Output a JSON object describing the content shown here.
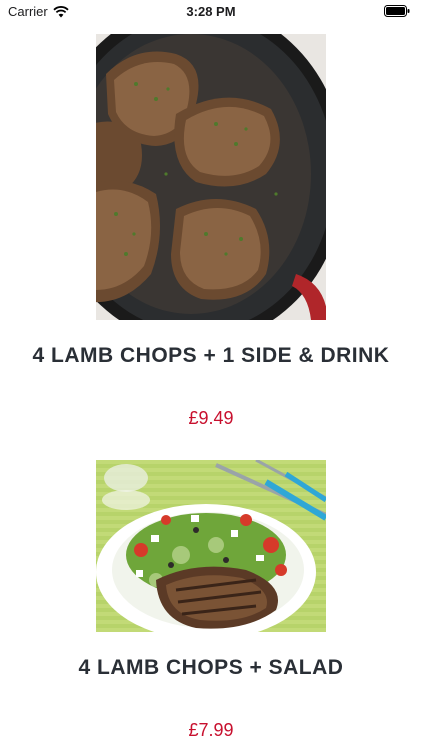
{
  "status_bar": {
    "carrier": "Carrier",
    "time": "3:28 PM",
    "icons": [
      "wifi-icon",
      "battery-icon"
    ]
  },
  "menu_items": [
    {
      "name": "4 LAMB CHOPS + 1 SIDE & DRINK",
      "price": "£9.49",
      "image": "lamb-chops-in-skillet"
    },
    {
      "name": "4 LAMB CHOPS + SALAD",
      "price": "£7.99",
      "image": "lamb-chops-with-salad"
    }
  ],
  "colors": {
    "price": "#c8102e",
    "title": "#2a2f36",
    "background": "#ffffff"
  }
}
